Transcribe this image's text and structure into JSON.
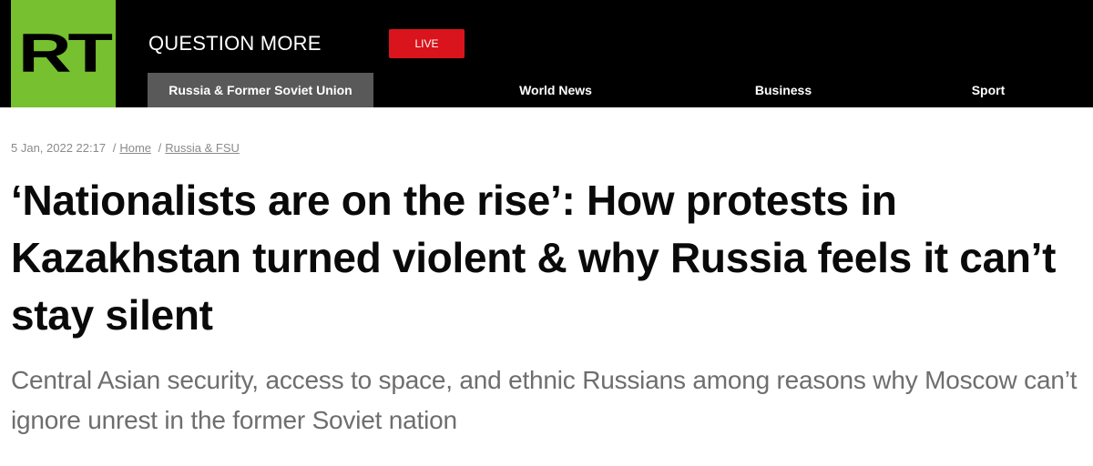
{
  "header": {
    "logo_text": "RT",
    "tagline": "QUESTION MORE",
    "live_label": "LIVE",
    "colors": {
      "logo_bg": "#77c02f",
      "header_bg": "#000000",
      "live_bg": "#d9141c",
      "active_nav_bg": "#595959"
    }
  },
  "nav": {
    "items": [
      {
        "label": "Russia & Former Soviet Union",
        "active": true
      },
      {
        "label": "World News",
        "active": false
      },
      {
        "label": "Business",
        "active": false
      },
      {
        "label": "Sport",
        "active": false
      }
    ]
  },
  "article": {
    "date": "5 Jan, 2022 22:17",
    "breadcrumb": [
      "Home",
      "Russia & FSU"
    ],
    "separator": "/",
    "headline": "‘Nationalists are on the rise’: How protests in Kazakhstan turned violent & why Russia feels it can’t stay silent",
    "summary": "Central Asian security, access to space, and ethnic Russians among reasons why Moscow can’t ignore unrest in the former Soviet nation"
  }
}
